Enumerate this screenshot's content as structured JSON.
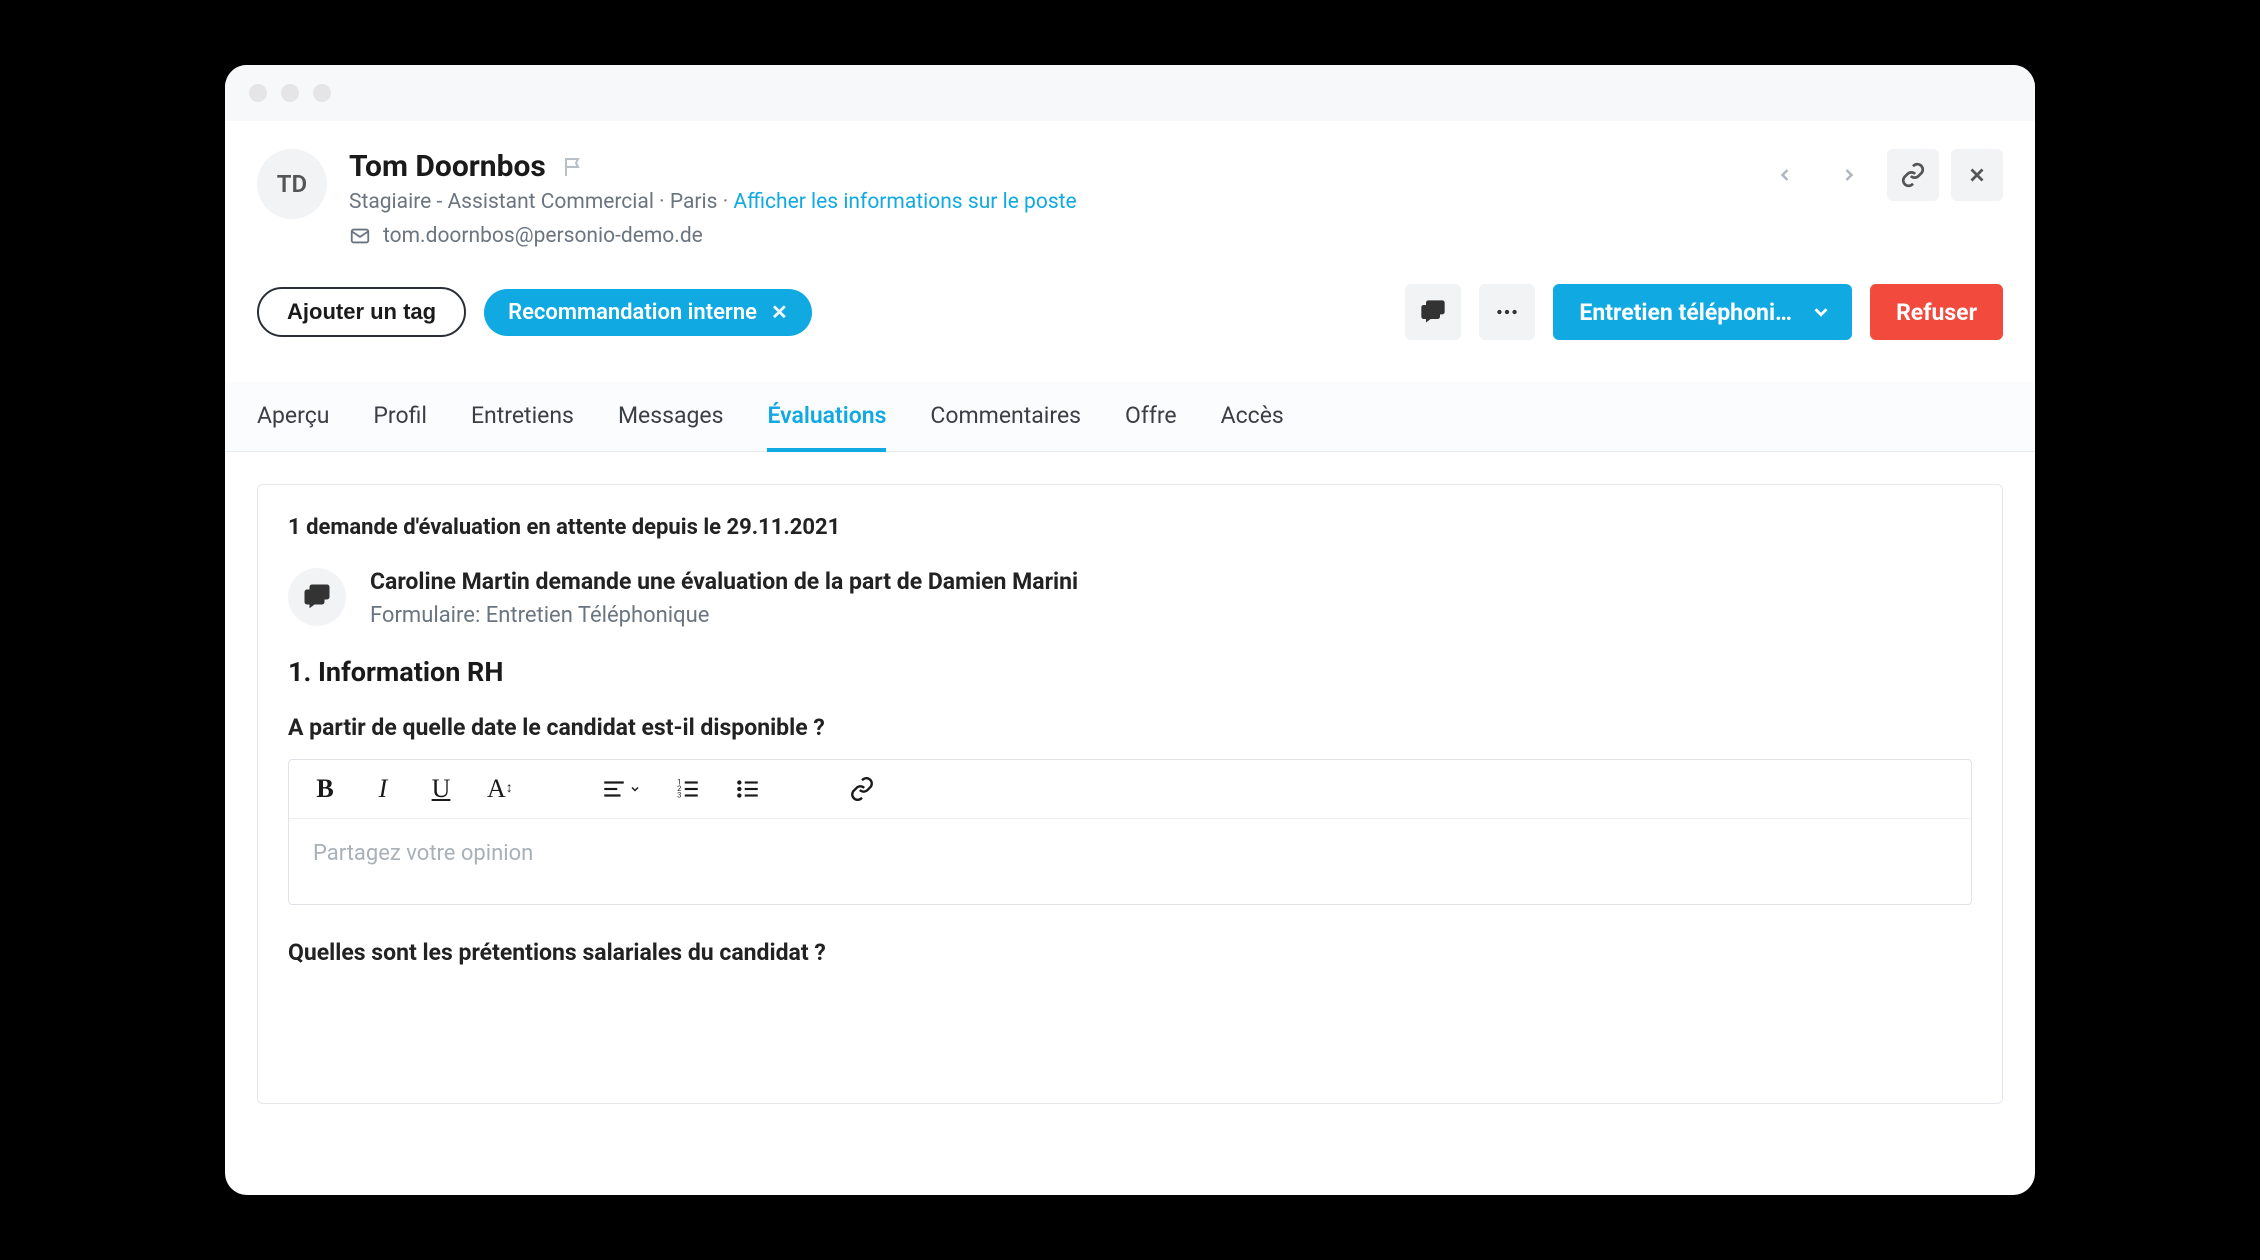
{
  "candidate": {
    "initials": "TD",
    "name": "Tom Doornbos",
    "subtitle_role": "Stagiaire - Assistant Commercial",
    "subtitle_location": "Paris",
    "position_link": "Afficher les informations sur le poste",
    "email": "tom.doornbos@personio-demo.de"
  },
  "tags": {
    "add_label": "Ajouter un tag",
    "items": [
      {
        "label": "Recommandation interne"
      }
    ]
  },
  "actions": {
    "stage_label": "Entretien téléphoni…",
    "refuse_label": "Refuser"
  },
  "tabs": [
    {
      "label": "Aperçu",
      "active": false
    },
    {
      "label": "Profil",
      "active": false
    },
    {
      "label": "Entretiens",
      "active": false
    },
    {
      "label": "Messages",
      "active": false
    },
    {
      "label": "Évaluations",
      "active": true
    },
    {
      "label": "Commentaires",
      "active": false
    },
    {
      "label": "Offre",
      "active": false
    },
    {
      "label": "Accès",
      "active": false
    }
  ],
  "evaluation": {
    "pending_text": "1 demande d'évaluation en attente depuis le 29.11.2021",
    "request_line": "Caroline Martin demande une évaluation de la part de Damien Marini",
    "form_line": "Formulaire: Entretien Téléphonique",
    "section_title": "1. Information RH",
    "question1": "A partir de quelle date le candidat est-il disponible ?",
    "editor_placeholder": "Partagez votre opinion",
    "question2": "Quelles sont les prétentions salariales du candidat ?"
  },
  "colors": {
    "primary": "#10a9e2",
    "danger": "#f24a3d"
  }
}
